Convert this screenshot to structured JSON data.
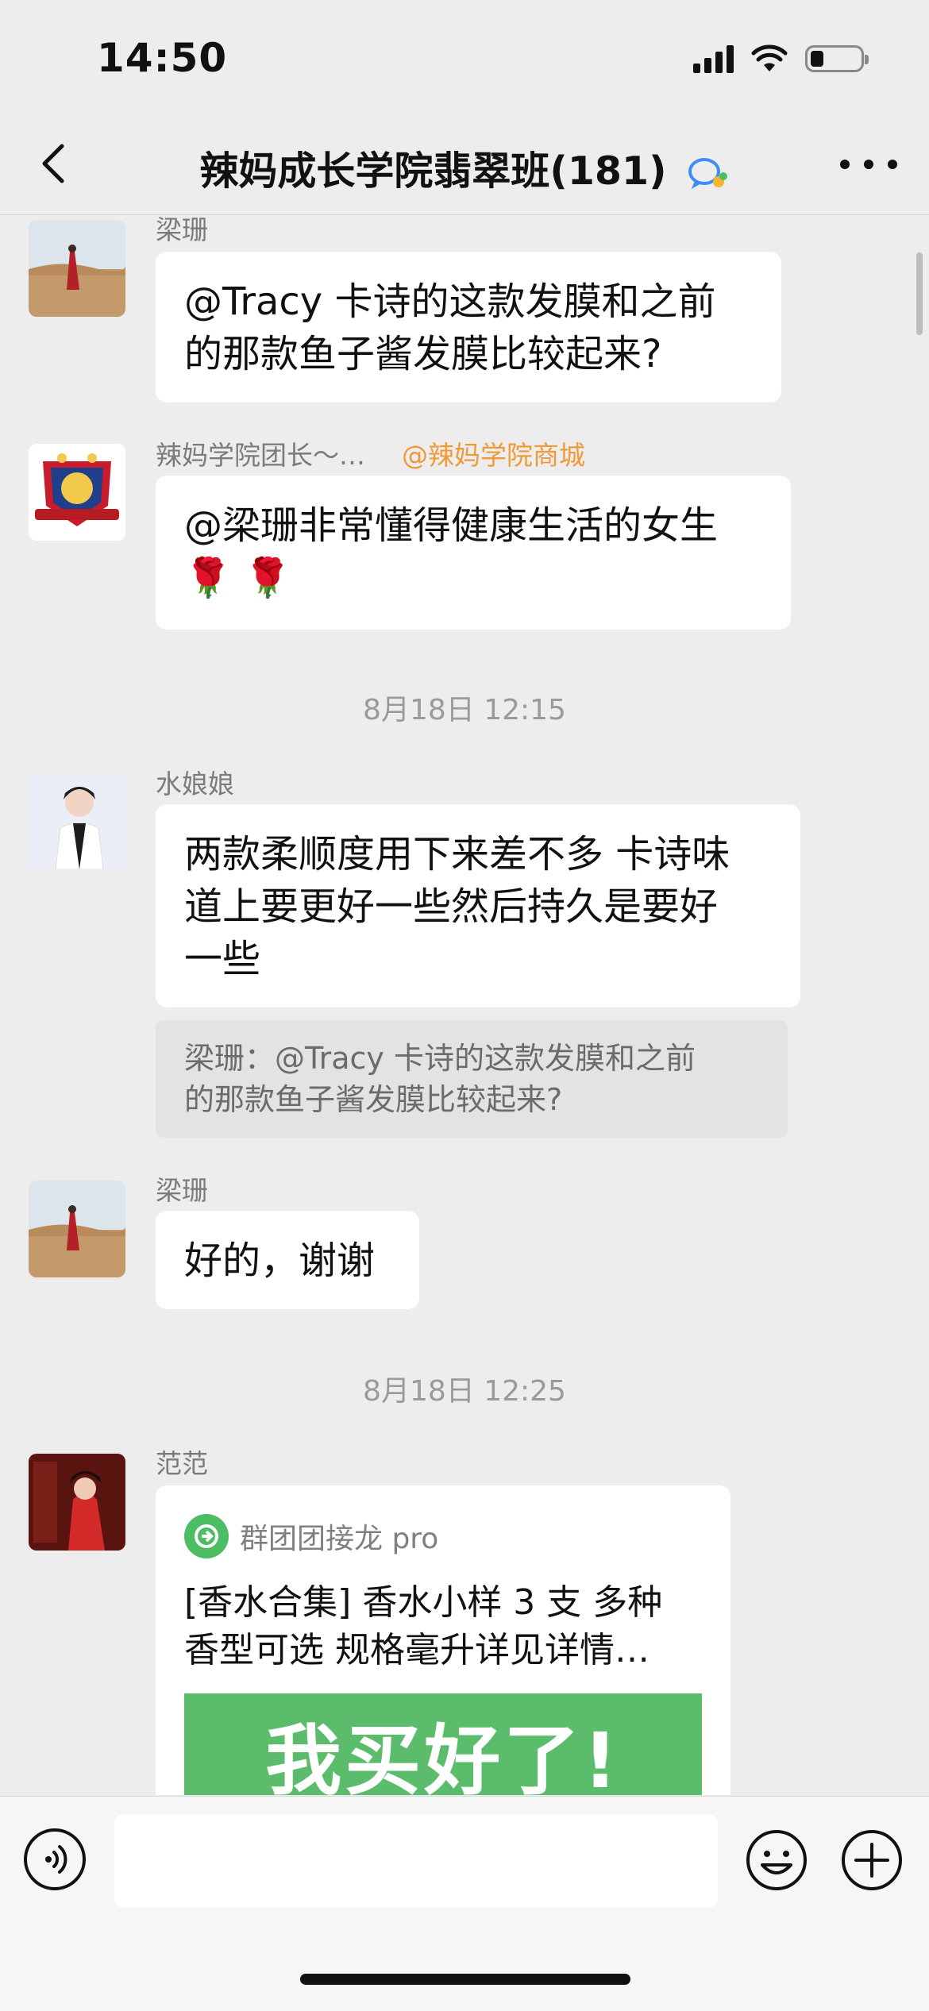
{
  "status_bar": {
    "time": "14:50",
    "battery_level": 0.25
  },
  "header": {
    "title": "辣妈成长学院翡翠班(181)"
  },
  "messages": [
    {
      "sender": "梁珊",
      "text_line1": "@Tracy  卡诗的这款发膜和之前",
      "text_line2": "的那款鱼子酱发膜比较起来?"
    },
    {
      "sender": "辣妈学院团长～…",
      "mention": "@辣妈学院商城",
      "text_line1": "@梁珊非常懂得健康生活的女生",
      "text_line2": "🌹 🌹"
    },
    {
      "sender": "水娘娘",
      "text_line1": "两款柔顺度用下来差不多 卡诗味",
      "text_line2": "道上要更好一些然后持久是要好",
      "text_line3": "一些",
      "quote_line1": "梁珊：@Tracy  卡诗的这款发膜和之前",
      "quote_line2": "的那款鱼子酱发膜比较起来?"
    },
    {
      "sender": "梁珊",
      "text_line1": "好的，谢谢"
    },
    {
      "sender": "范范",
      "card_app": "群团团接龙 pro",
      "card_line1": "[香水合集] 香水小样 3 支 多种",
      "card_line2": "香型可选 规格毫升详见详情…",
      "card_banner": "我买好了!"
    }
  ],
  "time_separators": [
    "8月18日 12:15",
    "8月18日 12:25"
  ],
  "input": {
    "placeholder": ""
  },
  "colors": {
    "background": "#ededed",
    "bubble": "#ffffff",
    "mention": "#f09a37",
    "card_banner": "#5bbd6b"
  }
}
